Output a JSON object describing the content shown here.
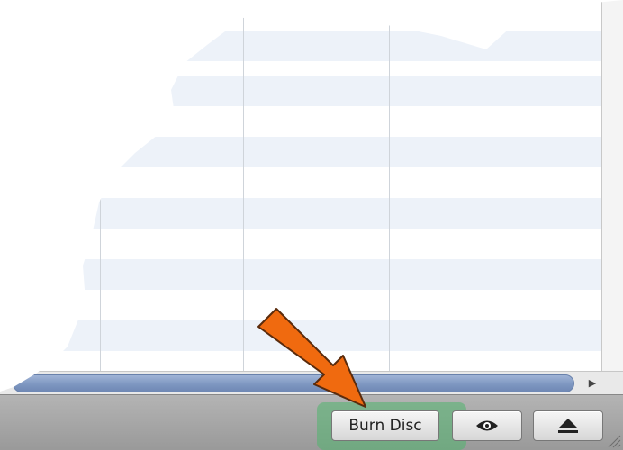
{
  "list": {
    "row_count": 12,
    "stripe_color": "#edf2f9"
  },
  "horizontal_scrollbar": {
    "right_arrow_icon": "triangle-right-icon"
  },
  "bottom_bar": {
    "burn_button_label": "Burn Disc",
    "preview_icon": "eye-icon",
    "eject_icon": "eject-icon"
  },
  "annotation": {
    "arrow_color": "#f06a0f",
    "highlight_color": "#4fb46e"
  }
}
